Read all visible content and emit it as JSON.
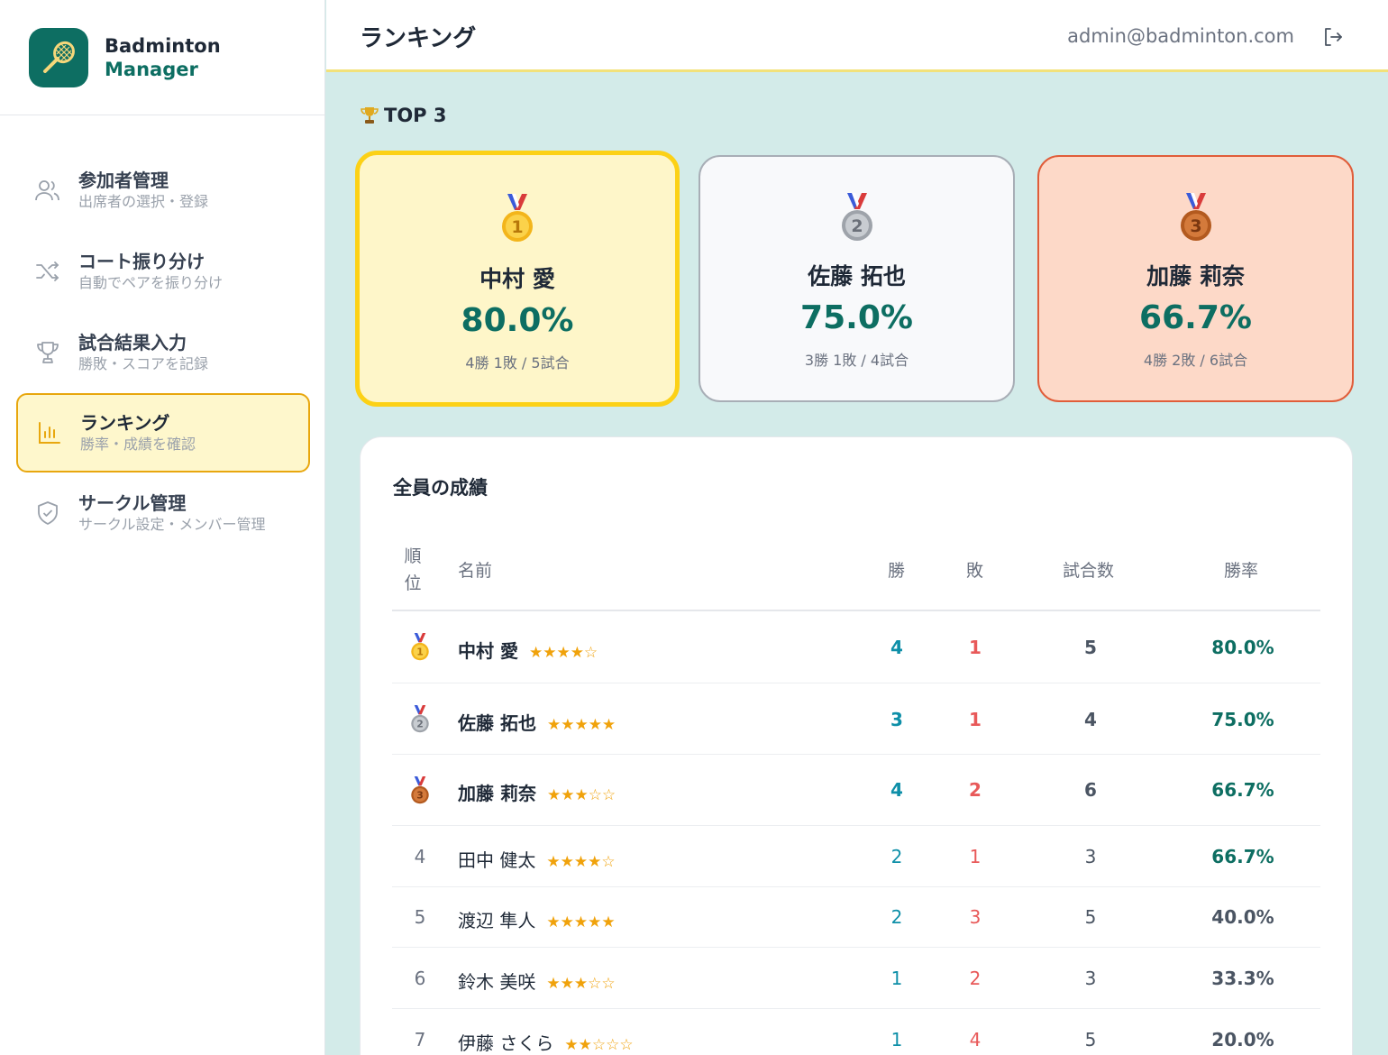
{
  "brand": {
    "title": "Badminton",
    "subtitle": "Manager"
  },
  "nav": [
    {
      "label": "参加者管理",
      "desc": "出席者の選択・登録",
      "icon": "users-icon"
    },
    {
      "label": "コート振り分け",
      "desc": "自動でペアを振り分け",
      "icon": "shuffle-icon"
    },
    {
      "label": "試合結果入力",
      "desc": "勝敗・スコアを記録",
      "icon": "trophy-icon"
    },
    {
      "label": "ランキング",
      "desc": "勝率・成績を確認",
      "icon": "bar-chart-icon",
      "active": true
    },
    {
      "label": "サークル管理",
      "desc": "サークル設定・メンバー管理",
      "icon": "shield-check-icon"
    }
  ],
  "header": {
    "title": "ランキング",
    "user_email": "admin@badminton.com"
  },
  "top3": {
    "title": "TOP 3",
    "cards": [
      {
        "medal": "1",
        "name": "中村 愛",
        "rate": "80.0%",
        "record": "4勝 1敗 / 5試合"
      },
      {
        "medal": "2",
        "name": "佐藤 拓也",
        "rate": "75.0%",
        "record": "3勝 1敗 / 4試合"
      },
      {
        "medal": "3",
        "name": "加藤 莉奈",
        "rate": "66.7%",
        "record": "4勝 2敗 / 6試合"
      }
    ]
  },
  "table": {
    "title": "全員の成績",
    "headers": {
      "rank_line1": "順",
      "rank_line2": "位",
      "name": "名前",
      "wins": "勝",
      "losses": "敗",
      "games": "試合数",
      "rate": "勝率"
    },
    "rows": [
      {
        "rank": "1",
        "name": "中村 愛",
        "stars": "★★★★☆",
        "wins": "4",
        "losses": "1",
        "games": "5",
        "rate": "80.0%"
      },
      {
        "rank": "2",
        "name": "佐藤 拓也",
        "stars": "★★★★★",
        "wins": "3",
        "losses": "1",
        "games": "4",
        "rate": "75.0%"
      },
      {
        "rank": "3",
        "name": "加藤 莉奈",
        "stars": "★★★☆☆",
        "wins": "4",
        "losses": "2",
        "games": "6",
        "rate": "66.7%"
      },
      {
        "rank": "4",
        "name": "田中 健太",
        "stars": "★★★★☆",
        "wins": "2",
        "losses": "1",
        "games": "3",
        "rate": "66.7%"
      },
      {
        "rank": "5",
        "name": "渡辺 隼人",
        "stars": "★★★★★",
        "wins": "2",
        "losses": "3",
        "games": "5",
        "rate": "40.0%"
      },
      {
        "rank": "6",
        "name": "鈴木 美咲",
        "stars": "★★★☆☆",
        "wins": "1",
        "losses": "2",
        "games": "3",
        "rate": "33.3%"
      },
      {
        "rank": "7",
        "name": "伊藤 さくら",
        "stars": "★★☆☆☆",
        "wins": "1",
        "losses": "4",
        "games": "5",
        "rate": "20.0%"
      }
    ]
  },
  "colors": {
    "primary": "#0d6e62",
    "accent": "#fcd116",
    "win": "#0e8fa8",
    "loss": "#e85959"
  }
}
